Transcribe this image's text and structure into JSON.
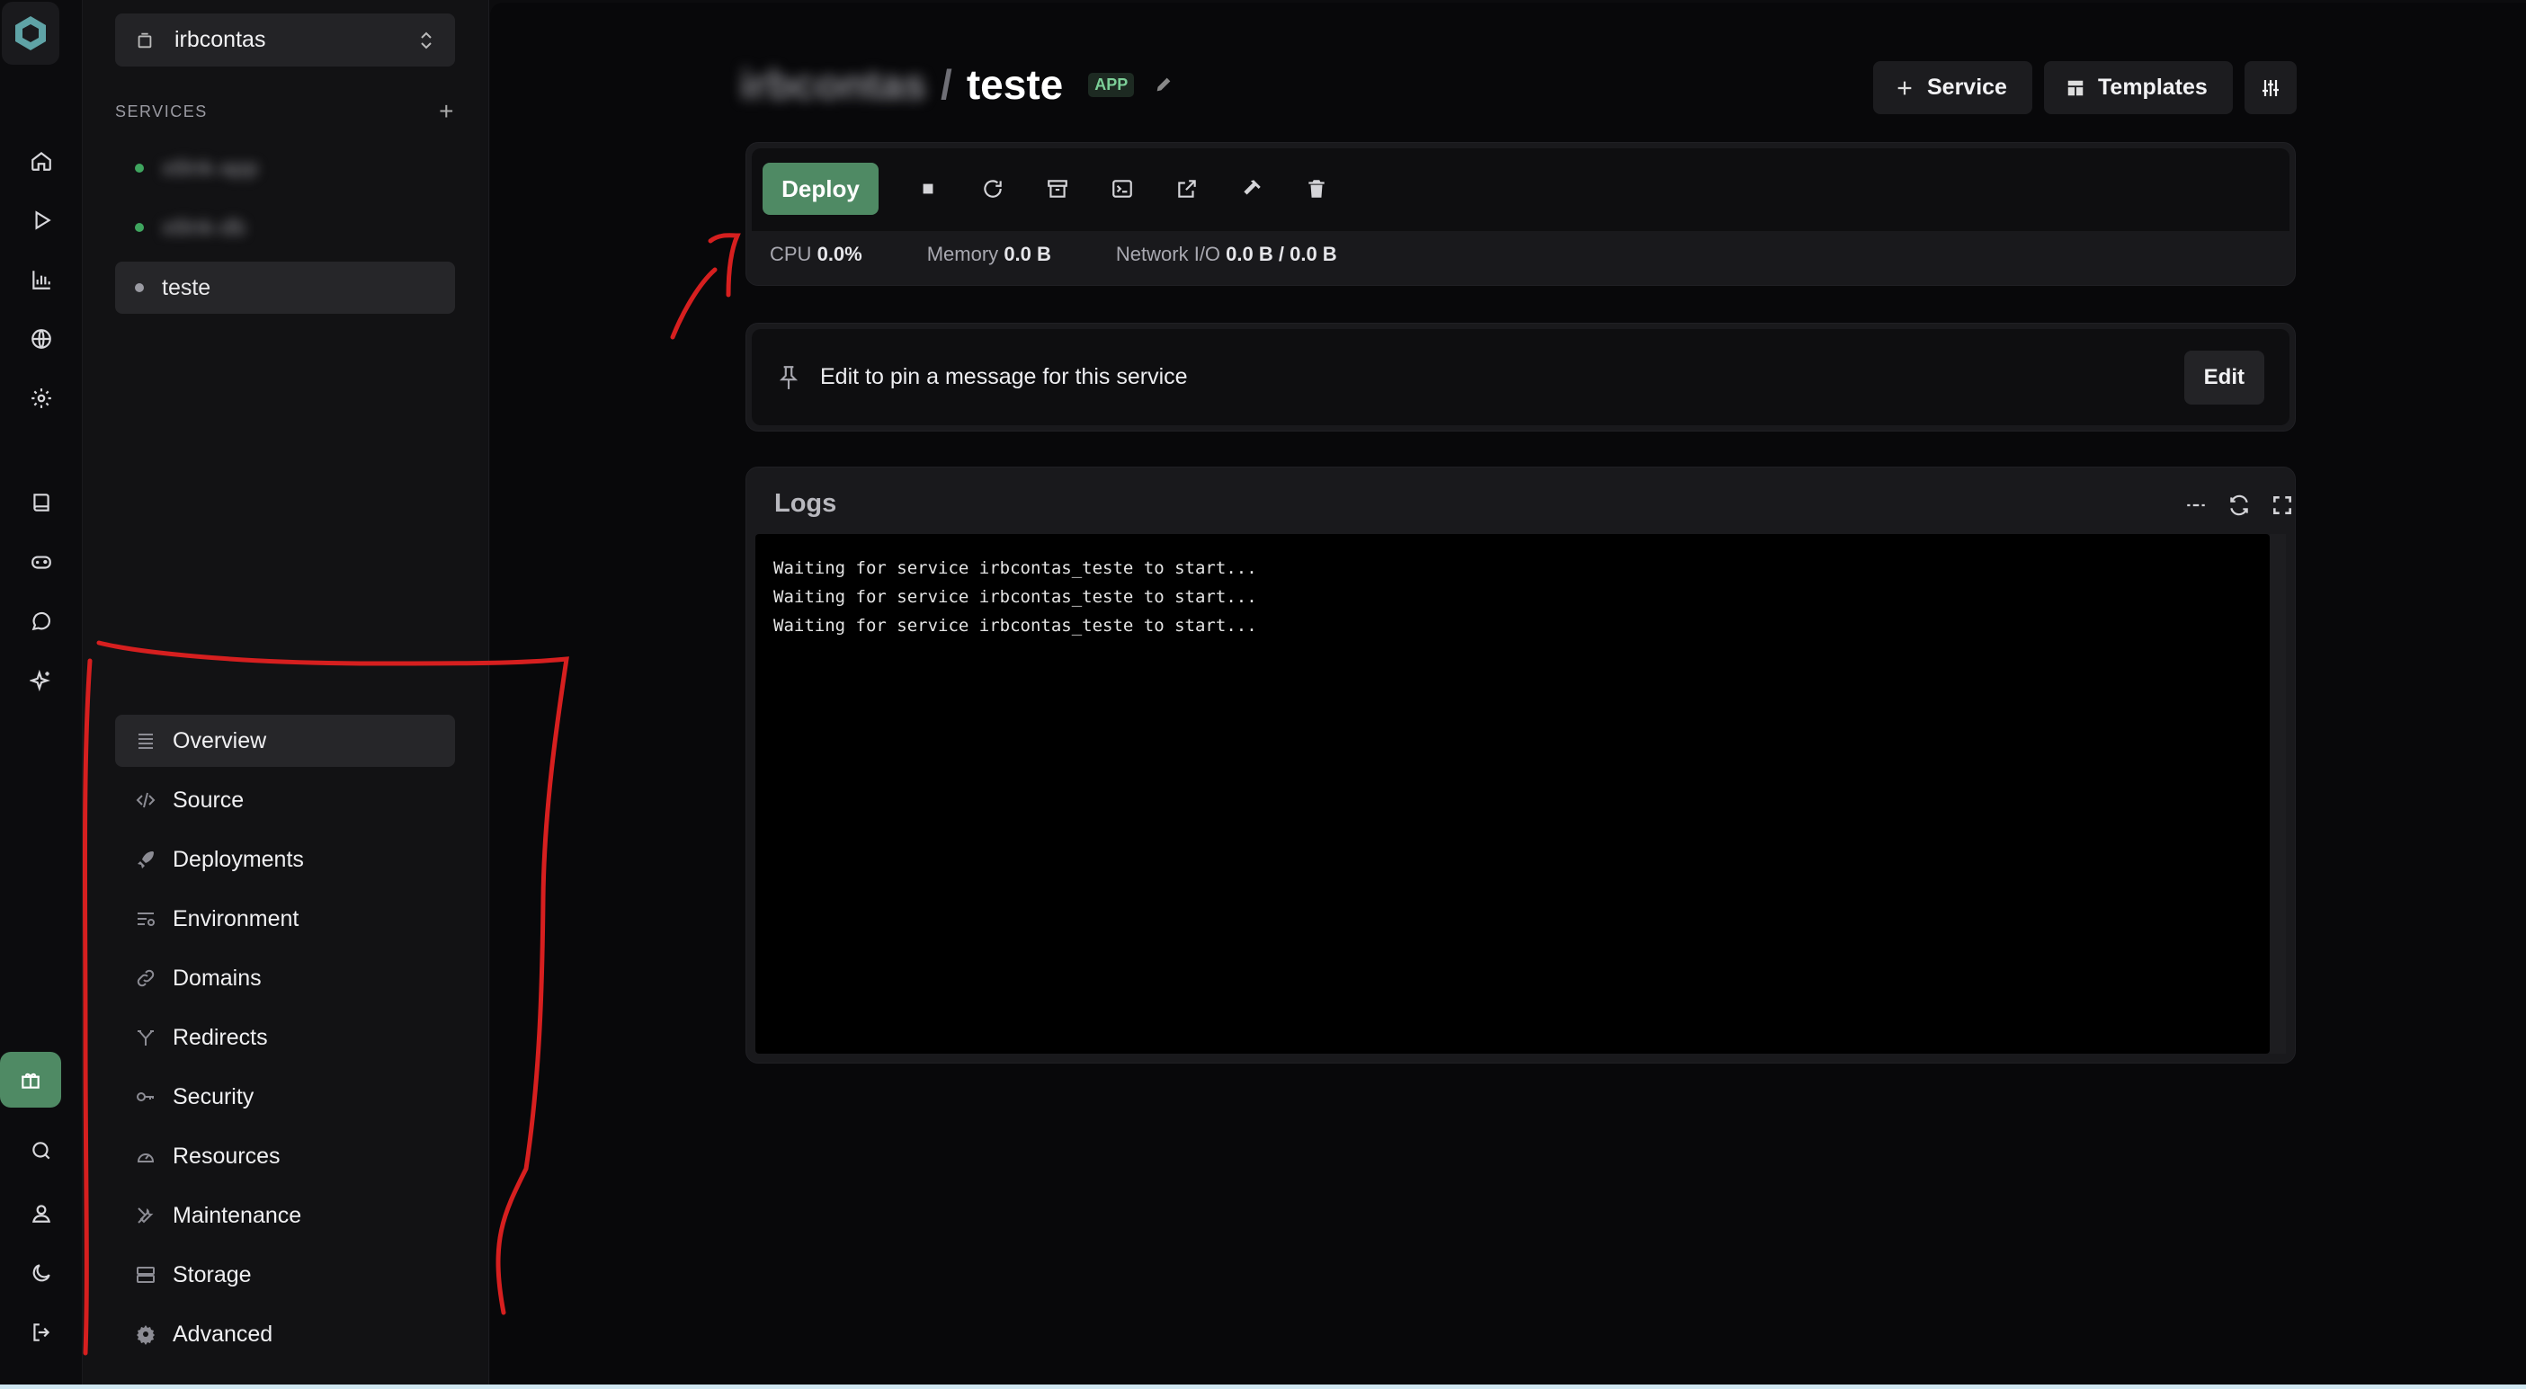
{
  "project": {
    "name": "irbcontas"
  },
  "services_header": "SERVICES",
  "services": [
    {
      "name": "xtlink-app",
      "status": "running",
      "blurred": true
    },
    {
      "name": "xtlink-db",
      "status": "running",
      "blurred": true
    },
    {
      "name": "teste",
      "status": "stopped",
      "blurred": false
    }
  ],
  "nav": [
    {
      "label": "Overview",
      "icon": "list-icon"
    },
    {
      "label": "Source",
      "icon": "code-icon"
    },
    {
      "label": "Deployments",
      "icon": "rocket-icon"
    },
    {
      "label": "Environment",
      "icon": "variables-icon"
    },
    {
      "label": "Domains",
      "icon": "link-icon"
    },
    {
      "label": "Redirects",
      "icon": "split-icon"
    },
    {
      "label": "Security",
      "icon": "key-icon"
    },
    {
      "label": "Resources",
      "icon": "gauge-icon"
    },
    {
      "label": "Maintenance",
      "icon": "tools-icon"
    },
    {
      "label": "Storage",
      "icon": "server-icon"
    },
    {
      "label": "Advanced",
      "icon": "cog-icon"
    }
  ],
  "breadcrumb": {
    "project": "irbcontas",
    "separator": "/",
    "service": "teste",
    "badge": "APP"
  },
  "top_actions": {
    "service": "Service",
    "templates": "Templates"
  },
  "deploy": {
    "label": "Deploy"
  },
  "stats": {
    "cpu_label": "CPU",
    "cpu_value": "0.0%",
    "memory_label": "Memory",
    "memory_value": "0.0 B",
    "network_label": "Network I/O",
    "network_value": "0.0 B / 0.0 B"
  },
  "pin": {
    "text": "Edit to pin a message for this service",
    "edit": "Edit"
  },
  "logs": {
    "title": "Logs",
    "lines": [
      "Waiting for service irbcontas_teste to start...",
      "Waiting for service irbcontas_teste to start...",
      "Waiting for service irbcontas_teste to start..."
    ]
  },
  "colors": {
    "accent": "#4f8a64",
    "running": "#3fa55f",
    "stopped": "#9a9aa2",
    "annotation": "#d61f1f"
  }
}
